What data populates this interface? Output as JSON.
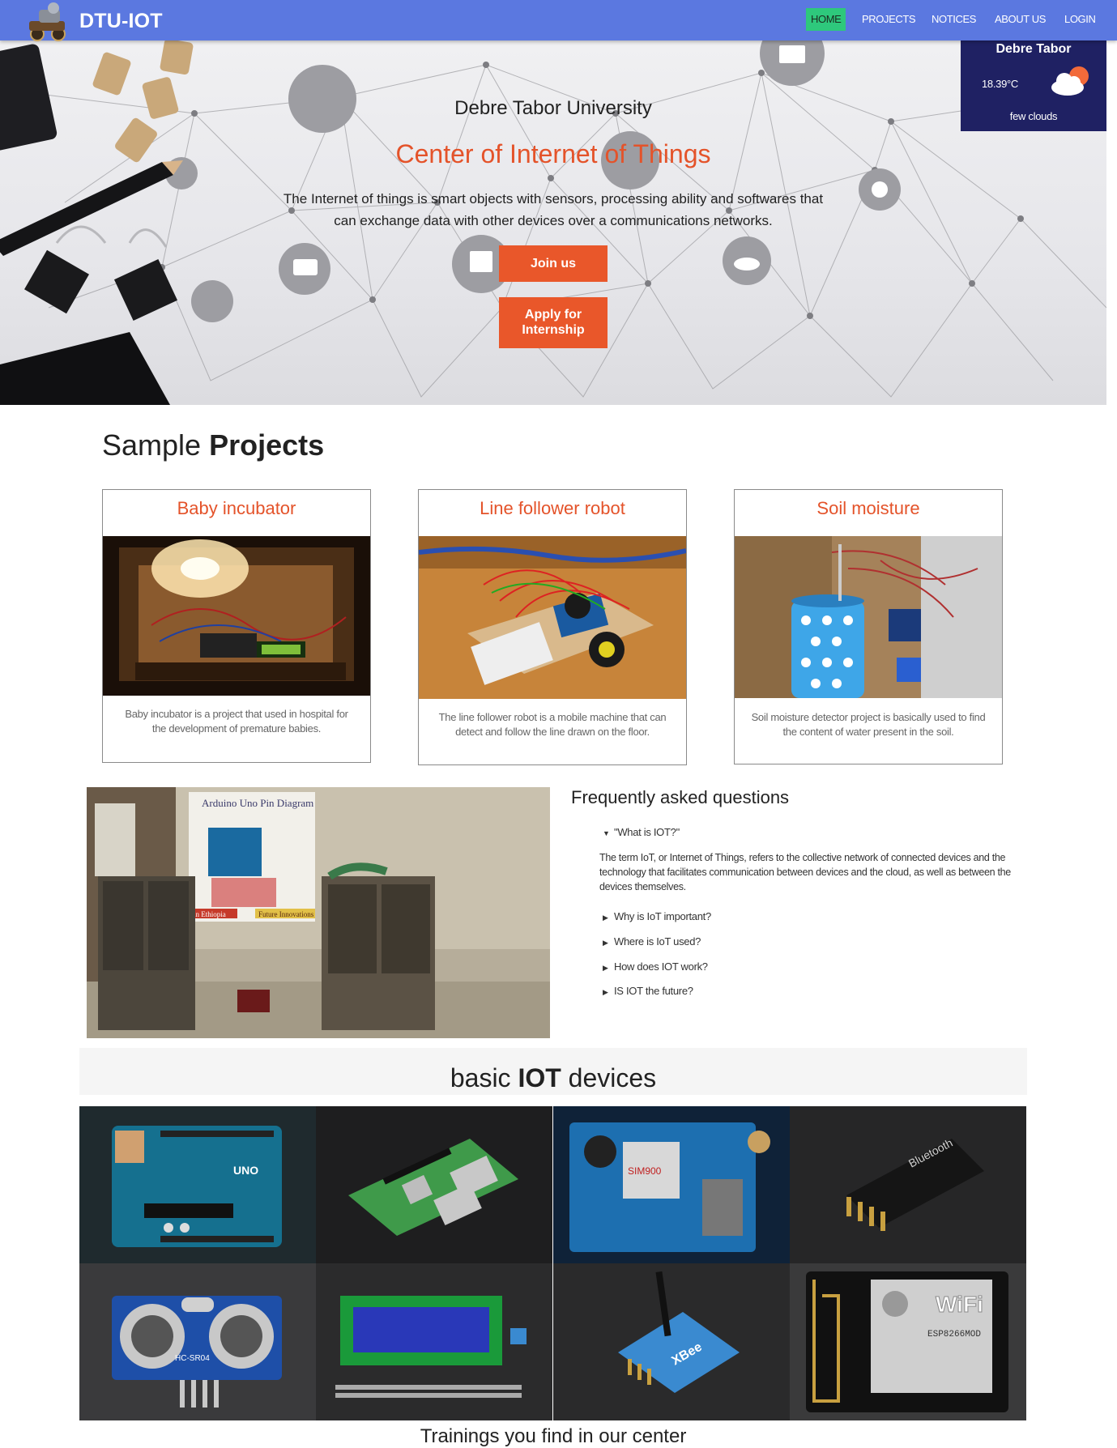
{
  "brand": {
    "name": "DTU-IOT"
  },
  "nav": {
    "items": [
      "HOME",
      "PROJECTS",
      "NOTICES",
      "ABOUT US",
      "LOGIN"
    ],
    "active_color": "#2ec87c",
    "bar_color": "#5b78e0"
  },
  "weather": {
    "city": "Debre Tabor",
    "temperature": "18.39°C",
    "description": "few clouds",
    "icon": "cloud-sun-icon",
    "bg_color": "#1f2163"
  },
  "hero": {
    "university": "Debre Tabor University",
    "center": "Center of Internet of Things",
    "description": "The Internet of things is smart objects with sensors, processing ability and softwares that can exchange data with other devices over a communications networks.",
    "join_label": "Join us",
    "intern_label": "Apply for Internship",
    "accent": "#e9572a"
  },
  "projects": {
    "title_light": "Sample",
    "title_bold": "Projects",
    "cards": [
      {
        "title": "Baby incubator",
        "text": "Baby incubator is a project that used in hospital for the development of premature babies."
      },
      {
        "title": "Line follower robot",
        "text": "The line follower robot is a mobile machine that can detect and follow the line drawn on the floor."
      },
      {
        "title": "Soil moisture",
        "text": "Soil moisture detector project is basically used to find the content of water present in the soil."
      }
    ]
  },
  "faq": {
    "title": "Frequently asked questions",
    "open_question": "\"What is IOT?\"",
    "open_answer": "The term IoT, or Internet of Things, refers to the collective network of connected devices and the technology that facilitates communication between devices and the cloud, as well as between the devices themselves.",
    "questions": [
      "Why is IoT important?",
      "Where is IoT used?",
      "How does IOT work?",
      "IS IOT the future?"
    ],
    "photo_labels": {
      "poster_title": "Arduino Uno Pin Diagram",
      "poster_left": "in Ethiopia",
      "poster_right": "Future Innovations"
    }
  },
  "devices": {
    "title_light_1": "basic",
    "title_bold": "IOT",
    "title_light_2": "devices",
    "items": [
      {
        "name": "arduino-uno",
        "label": "UNO"
      },
      {
        "name": "raspberry-pi"
      },
      {
        "name": "gsm-module",
        "label": "SIM900"
      },
      {
        "name": "bluetooth-module",
        "label": "Bluetooth"
      },
      {
        "name": "ultrasonic-sensor",
        "label": "HC-SR04"
      },
      {
        "name": "lcd-display"
      },
      {
        "name": "xbee-module",
        "label": "XBee"
      },
      {
        "name": "esp8266-module",
        "label": "WiFi",
        "sublabel": "ESP8266MOD"
      }
    ]
  },
  "trainings": {
    "title": "Trainings you find in our center"
  }
}
